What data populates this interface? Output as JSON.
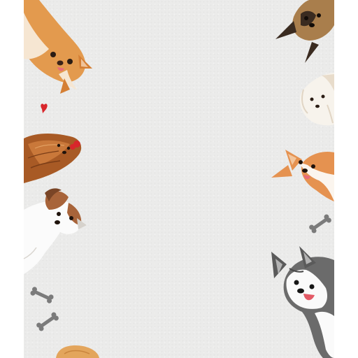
{
  "background": {
    "paper_color": "#ebebea",
    "margin_color": "#ffffff"
  },
  "illustrations": {
    "left_column": [
      {
        "name": "shiba-dog",
        "colors": [
          "#e39a4e",
          "#f6e6d2"
        ]
      },
      {
        "name": "heart",
        "colors": [
          "#d8262b"
        ]
      },
      {
        "name": "yorkshire-dog",
        "colors": [
          "#a85a25",
          "#d98f4d"
        ]
      },
      {
        "name": "jack-russell-dog",
        "colors": [
          "#fbfbfb",
          "#a8643a"
        ]
      },
      {
        "name": "bone",
        "colors": [
          "#7b7b7b"
        ]
      },
      {
        "name": "bone",
        "colors": [
          "#7b7b7b"
        ]
      },
      {
        "name": "golden-dog",
        "colors": [
          "#e3a55c"
        ]
      }
    ],
    "right_column": [
      {
        "name": "german-shepherd-dog",
        "colors": [
          "#a97e4c",
          "#3a2b20"
        ]
      },
      {
        "name": "maltese-dog",
        "colors": [
          "#f7f3ec",
          "#e8dccb"
        ]
      },
      {
        "name": "corgi-dog",
        "colors": [
          "#e59250",
          "#fbf5ee"
        ]
      },
      {
        "name": "bone",
        "colors": [
          "#7b7b7b"
        ]
      },
      {
        "name": "husky-dog",
        "colors": [
          "#6b6b6b",
          "#fafafa",
          "#e35a66"
        ]
      }
    ]
  }
}
